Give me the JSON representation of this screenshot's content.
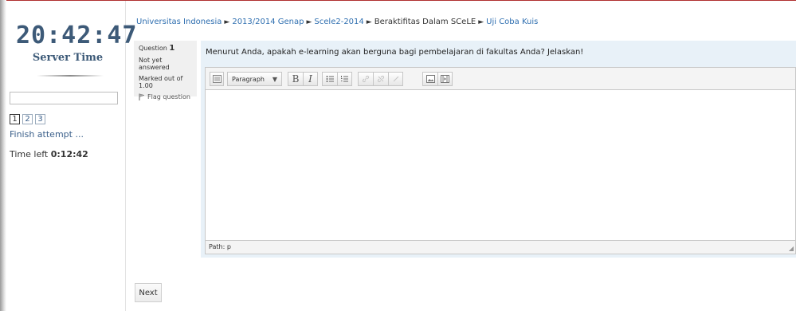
{
  "sidebar": {
    "clock": "20:42:47",
    "server_time_label": "Server Time",
    "search_value": "",
    "questions": [
      "1",
      "2",
      "3"
    ],
    "current_question": "1",
    "finish_link": "Finish attempt ...",
    "time_left_label": "Time left",
    "time_left_value": "0:12:42"
  },
  "breadcrumb": {
    "items": [
      "Universitas Indonesia",
      "2013/2014 Genap",
      "Scele2-2014",
      "Beraktifitas Dalam SCeLE",
      "Uji Coba Kuis"
    ],
    "separator": "►"
  },
  "question": {
    "label": "Question",
    "number": "1",
    "status": "Not yet answered",
    "marks": "Marked out of 1.00",
    "flag_label": "Flag question",
    "text": "Menurut Anda, apakah e-learning akan berguna bagi pembelajaran di fakultas Anda? Jelaskan!"
  },
  "editor": {
    "format_value": "Paragraph",
    "bold_label": "B",
    "italic_label": "I",
    "path_label": "Path: p",
    "content": ""
  },
  "navigation": {
    "next_label": "Next"
  },
  "colors": {
    "clock": "#3d5a78",
    "link": "#2f6fb0",
    "question_bg": "#e8f1f8",
    "info_bg": "#f0f0f0"
  }
}
